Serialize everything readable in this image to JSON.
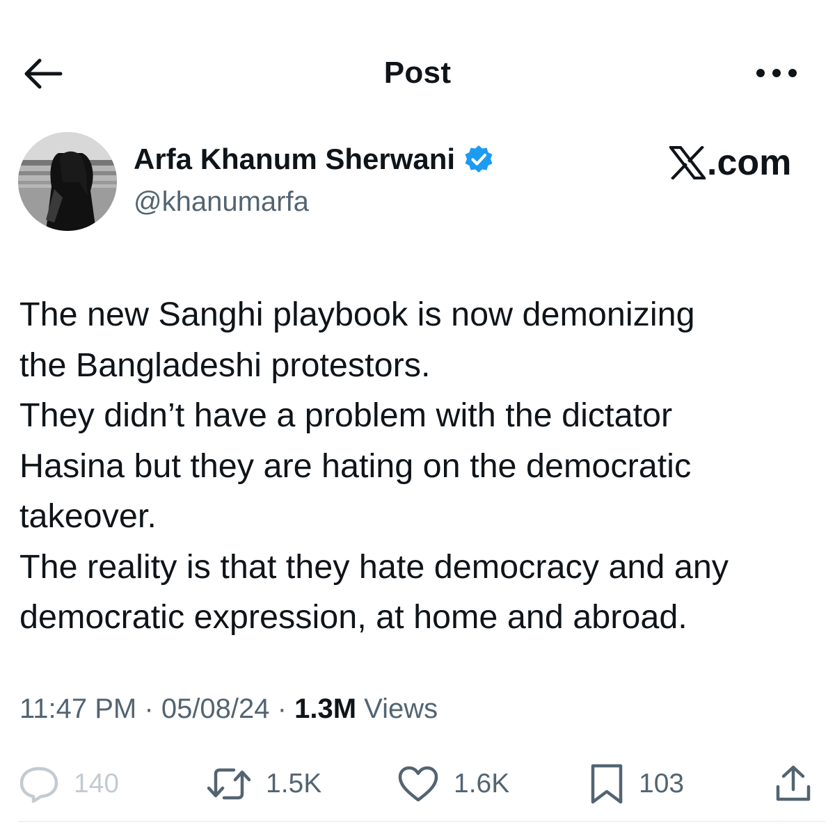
{
  "header": {
    "title": "Post",
    "back_icon": "arrow-left-icon",
    "more_icon": "ellipsis-icon"
  },
  "author": {
    "display_name": "Arfa Khanum Sherwani",
    "handle": "@khanumarfa",
    "verified_icon": "verified-badge-icon",
    "verified_color": "#1d9bf0"
  },
  "brand": {
    "logo_icon": "x-logo-icon",
    "text": ".com"
  },
  "post": {
    "lines": [
      "The new Sanghi playbook is now demonizing",
      "the Bangladeshi protestors.",
      "They didn’t have a problem with the dictator",
      "Hasina but they are hating on the democratic",
      "takeover.",
      "The reality is that they hate democracy and any",
      "democratic expression, at home and abroad."
    ]
  },
  "meta": {
    "time": "11:47 PM",
    "separator": "·",
    "date": "05/08/24",
    "views_count": "1.3M",
    "views_label": "Views"
  },
  "actions": {
    "replies": "140",
    "reposts": "1.5K",
    "likes": "1.6K",
    "bookmarks": "103"
  },
  "colors": {
    "text": "#0f1419",
    "secondary": "#536471",
    "accent": "#1d9bf0"
  }
}
